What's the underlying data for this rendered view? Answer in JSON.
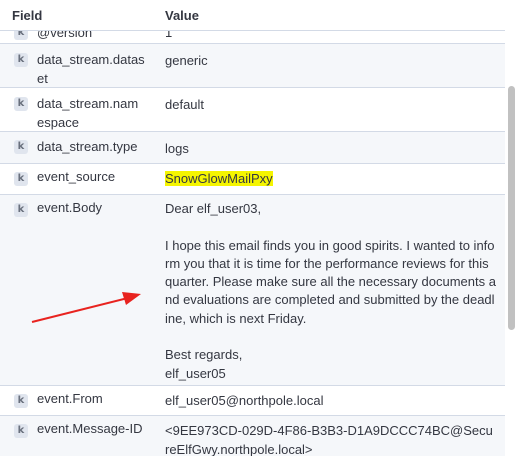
{
  "header": {
    "field_label": "Field",
    "value_label": "Value"
  },
  "rows": [
    {
      "type": "k",
      "field": "@version",
      "value": "1"
    },
    {
      "type": "k",
      "field": "data_stream.dataset",
      "value": "generic"
    },
    {
      "type": "k",
      "field": "data_stream.namespace",
      "value": "default"
    },
    {
      "type": "k",
      "field": "data_stream.type",
      "value": "logs"
    },
    {
      "type": "k",
      "field": "event_source",
      "value": "SnowGlowMailPxy"
    },
    {
      "type": "k",
      "field": "event.Body",
      "value": "Dear elf_user03,\n\nI hope this email finds you in good spirits. I wanted to inform you that it is time for the performance reviews for this quarter. Please make sure all the necessary documents and evaluations are completed and submitted by the deadline, which is next Friday.\n\nBest regards,\nelf_user05"
    },
    {
      "type": "k",
      "field": "event.From",
      "value": "elf_user05@northpole.local"
    },
    {
      "type": "k",
      "field": "event.Message-ID",
      "value": "<9EE973CD-029D-4F86-B3B3-D1A9DCCC74BC@SecureElfGwy.northpole.local>"
    }
  ],
  "annotation": {
    "color": "#e8231f"
  }
}
